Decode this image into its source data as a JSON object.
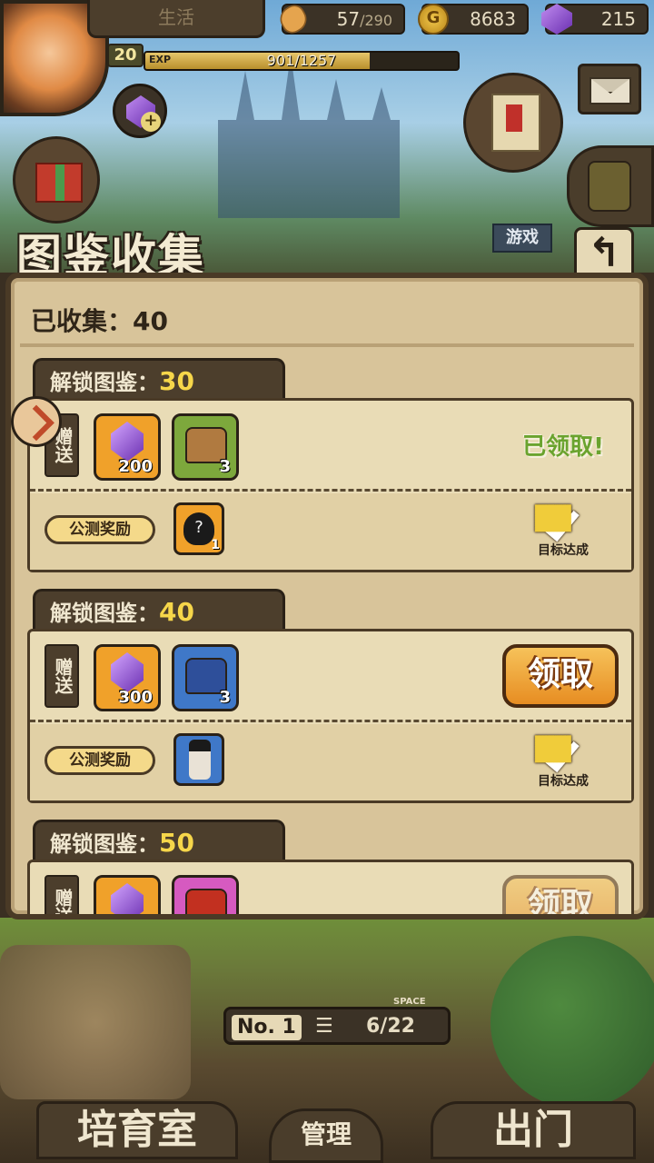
{
  "topbar": {
    "mode_tab": "生活",
    "level": "20",
    "exp_tag": "EXP",
    "exp_text": "901/1257",
    "exp_fraction": 0.717,
    "bread_value": "57",
    "bread_max": "/290",
    "gold_symbol": "G",
    "gold_value": "8683",
    "gem_value": "215"
  },
  "icons": {
    "avatar": "player-avatar",
    "gem_plus": "plus-icon",
    "mail": "mail-icon",
    "gift": "gift-icon",
    "quest": "scroll-icon",
    "bag": "backpack-icon",
    "back": "back-arrow-icon"
  },
  "side_sign": "游戏",
  "panel": {
    "title": "图鉴收集",
    "back_glyph": "↰",
    "collected_label": "已收集：40"
  },
  "cards": [
    {
      "unlock_label": "解锁图鉴：",
      "unlock_num": "30",
      "gift_label": "赠送",
      "gem_count": "200",
      "chest_count": "3",
      "chest_color": "wood",
      "status": "已领取!",
      "beta_label": "公测奖励",
      "beta_count": "1",
      "goal_text": "目标达成"
    },
    {
      "unlock_label": "解锁图鉴：",
      "unlock_num": "40",
      "gift_label": "赠送",
      "gem_count": "300",
      "chest_count": "3",
      "chest_color": "blue",
      "claim_label": "领取",
      "beta_label": "公测奖励",
      "goal_text": "目标达成"
    },
    {
      "unlock_label": "解锁图鉴：",
      "unlock_num": "50",
      "gift_label": "赠送",
      "chest_color": "pink",
      "claim_label": "领取"
    }
  ],
  "bottom": {
    "no_label": "No. 1",
    "space_label": "SPACE",
    "space_value": "6/22",
    "nav_left": "培育室",
    "nav_mid": "管理",
    "nav_right": "出门"
  },
  "colors": {
    "panel_bg": "#d8c49a",
    "claimed_text": "#6aa32e",
    "claim_button": "#e78d22",
    "highlight_number": "#f6d64a"
  }
}
